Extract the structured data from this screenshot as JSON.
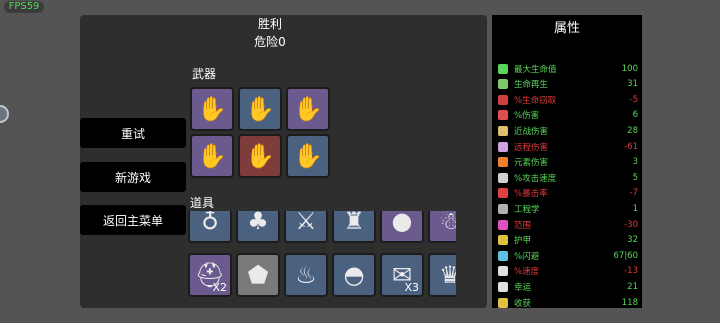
{
  "fps": "FPS59",
  "panel": {
    "title": "胜利",
    "subtitle": "危险0",
    "weapons_label": "武器",
    "items_label": "道具"
  },
  "menu": {
    "retry": "重试",
    "new_game": "新游戏",
    "main_menu": "返回主菜单"
  },
  "weapons": [
    {
      "tier": "t2c",
      "icon": "hand-icon"
    },
    {
      "tier": "t3c",
      "icon": "hand-icon"
    },
    {
      "tier": "t2c",
      "icon": "hand-icon"
    },
    {
      "tier": "t2c",
      "icon": "hand-icon"
    },
    {
      "tier": "red",
      "icon": "hand-icon"
    },
    {
      "tier": "t3c",
      "icon": "hand-icon"
    }
  ],
  "items": [
    {
      "tier": "t3c",
      "icon": "amulet-icon",
      "qty": ""
    },
    {
      "tier": "t3c",
      "icon": "clover-icon",
      "qty": ""
    },
    {
      "tier": "t3c",
      "icon": "claw-icon",
      "qty": ""
    },
    {
      "tier": "t3c",
      "icon": "cape-icon",
      "qty": ""
    },
    {
      "tier": "t2c",
      "icon": "slime-icon",
      "qty": ""
    },
    {
      "tier": "t2c",
      "icon": "ghost-icon",
      "qty": ""
    },
    {
      "tier": "t2c",
      "icon": "helmet-icon",
      "qty": "X2"
    },
    {
      "tier": "dark",
      "icon": "rock-icon",
      "qty": ""
    },
    {
      "tier": "t3c",
      "icon": "campfire-icon",
      "qty": ""
    },
    {
      "tier": "t3c",
      "icon": "bowler-hat-icon",
      "qty": ""
    },
    {
      "tier": "t3c",
      "icon": "scroll-icon",
      "qty": "X3"
    },
    {
      "tier": "t3c",
      "icon": "crown-icon",
      "qty": ""
    }
  ],
  "stats": {
    "title": "属性",
    "rows": [
      {
        "label": "最大生命值",
        "value": "100",
        "color": "#59d65a",
        "icon": "heart-icon",
        "icolor": "#59d65a"
      },
      {
        "label": "生命再生",
        "value": "31",
        "color": "#59d65a",
        "icon": "regen-icon",
        "icolor": "#7ec86a"
      },
      {
        "label": "%生命窃取",
        "value": "-5",
        "color": "#e03a3a",
        "icon": "lifesteal-icon",
        "icolor": "#d04040"
      },
      {
        "label": "%伤害",
        "value": "6",
        "color": "#59d65a",
        "icon": "damage-icon",
        "icolor": "#e05050"
      },
      {
        "label": "近战伤害",
        "value": "28",
        "color": "#59d65a",
        "icon": "melee-icon",
        "icolor": "#e0c070"
      },
      {
        "label": "远程伤害",
        "value": "-61",
        "color": "#e03a3a",
        "icon": "ranged-icon",
        "icolor": "#d0a0e0"
      },
      {
        "label": "元素伤害",
        "value": "3",
        "color": "#59d65a",
        "icon": "elemental-icon",
        "icolor": "#f08030"
      },
      {
        "label": "%攻击速度",
        "value": "5",
        "color": "#59d65a",
        "icon": "hourglass-icon",
        "icolor": "#d0d0d0"
      },
      {
        "label": "%暴击率",
        "value": "-7",
        "color": "#e03a3a",
        "icon": "crit-icon",
        "icolor": "#e04040"
      },
      {
        "label": "工程学",
        "value": "1",
        "color": "#59d65a",
        "icon": "wrench-icon",
        "icolor": "#b0b0b0"
      },
      {
        "label": "范围",
        "value": "-30",
        "color": "#e03a3a",
        "icon": "range-icon",
        "icolor": "#e050c0"
      },
      {
        "label": "护甲",
        "value": "32",
        "color": "#59d65a",
        "icon": "armor-icon",
        "icolor": "#e0c040"
      },
      {
        "label": "%闪避",
        "value": "67|60",
        "color": "#59d65a",
        "icon": "dodge-icon",
        "icolor": "#60c0e0"
      },
      {
        "label": "%速度",
        "value": "-13",
        "color": "#e03a3a",
        "icon": "speed-icon",
        "icolor": "#e0e0e0"
      },
      {
        "label": "幸运",
        "value": "21",
        "color": "#59d65a",
        "icon": "luck-icon",
        "icolor": "#e0e0e0"
      },
      {
        "label": "收获",
        "value": "118",
        "color": "#59d65a",
        "icon": "harvest-icon",
        "icolor": "#e0c040"
      }
    ]
  }
}
